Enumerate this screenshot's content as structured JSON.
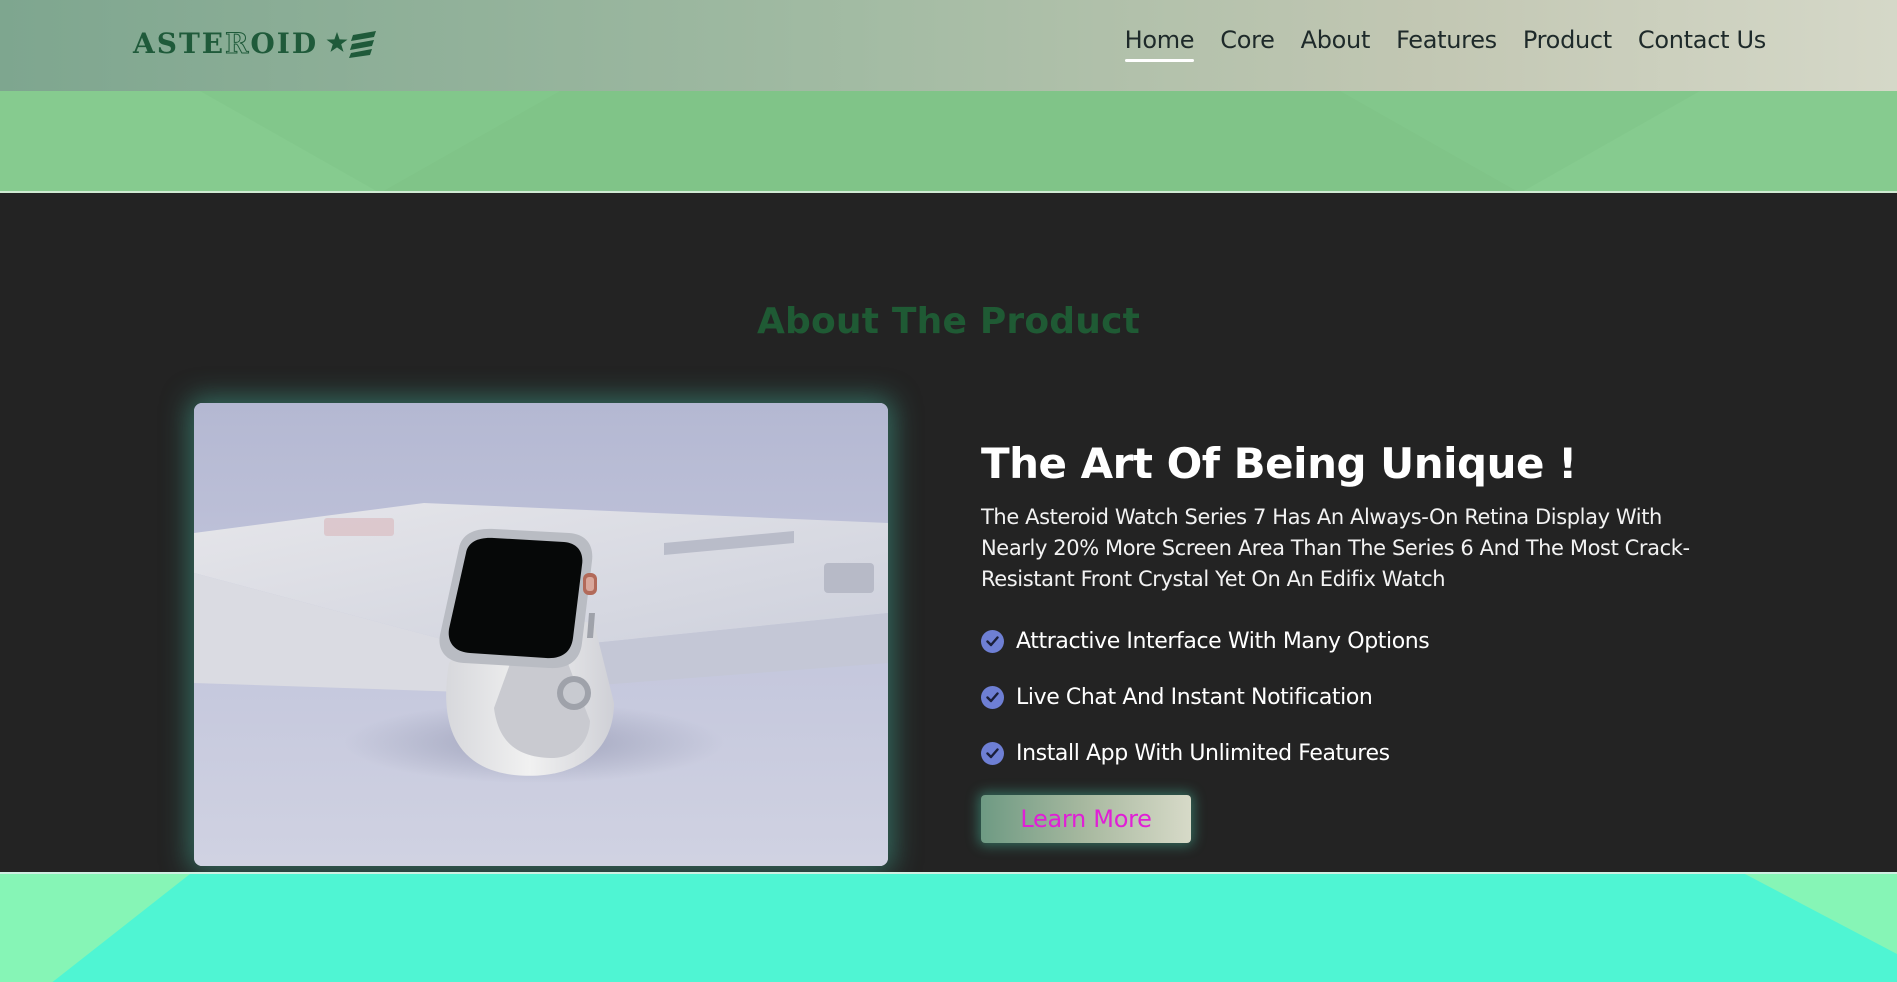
{
  "header": {
    "logo_text": "ASTEROID",
    "logo_icon": "star-icon",
    "nav": [
      {
        "label": "Home",
        "active": true
      },
      {
        "label": "Core",
        "active": false
      },
      {
        "label": "About",
        "active": false
      },
      {
        "label": "Features",
        "active": false
      },
      {
        "label": "Product",
        "active": false
      },
      {
        "label": "Contact Us",
        "active": false
      }
    ]
  },
  "about": {
    "section_title": "About The Product",
    "headline": "The Art Of Being Unique !",
    "description": "The Asteroid Watch Series 7 Has An Always-On Retina Display With Nearly 20% More Screen Area Than The Series 6 And The Most Crack-Resistant Front Crystal Yet On An Edifix Watch",
    "features": [
      "Attractive Interface With Many Options",
      "Live Chat And Instant Notification",
      "Install App With Unlimited Features"
    ],
    "cta_label": "Learn More",
    "feature_icon": "check-circle-icon",
    "image_alt": "white smartwatch on a white box"
  },
  "colors": {
    "accent_green": "#1f5a34",
    "band_green": "#82c78b",
    "band_mint": "#4ff5d3",
    "check_icon": "#6e7fd4",
    "cta_text": "#e01fd6"
  }
}
